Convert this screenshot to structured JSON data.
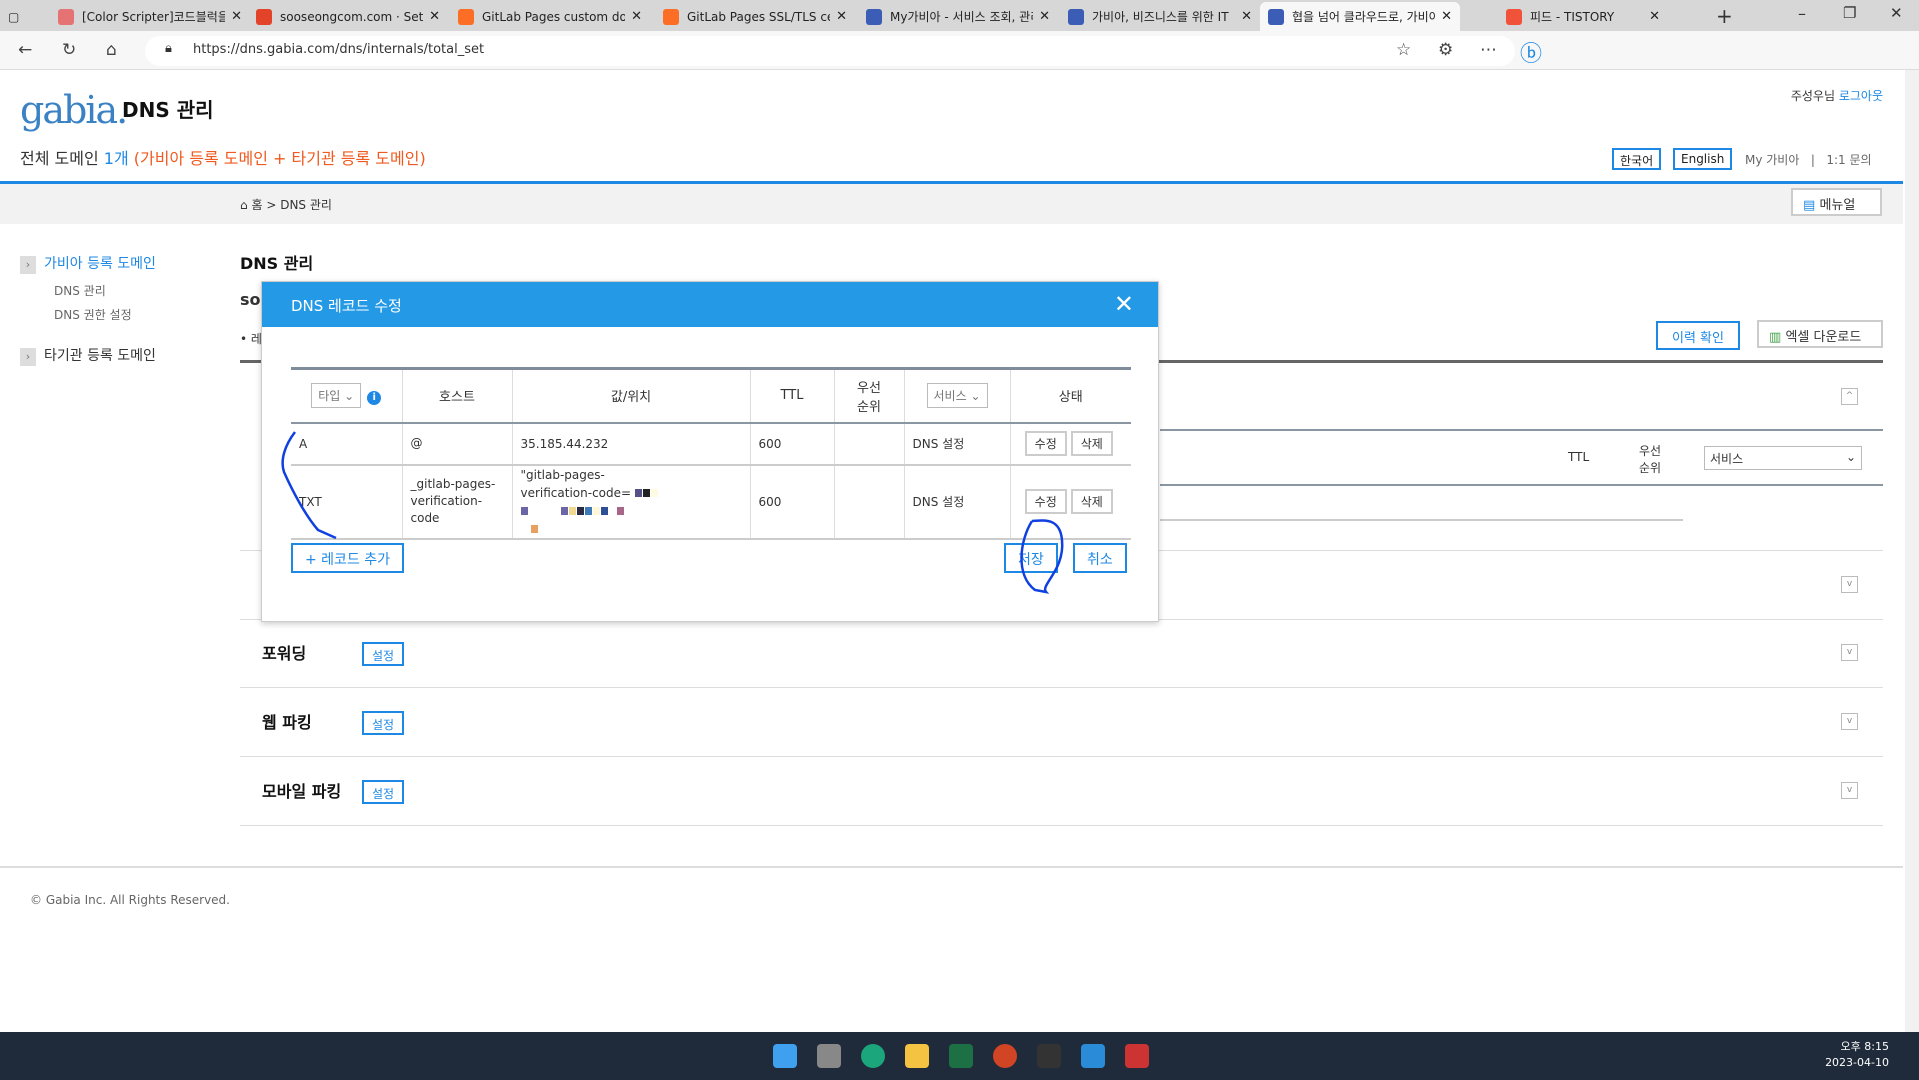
{
  "browser": {
    "tabs": [
      {
        "title": "[Color Scripter]코드블럭을",
        "color": "#e57373"
      },
      {
        "title": "sooseongcom.com · Settings",
        "color": "#e24329"
      },
      {
        "title": "GitLab Pages custom dom",
        "color": "#fc6d26"
      },
      {
        "title": "GitLab Pages SSL/TLS cert",
        "color": "#fc6d26"
      },
      {
        "title": "My가비아 - 서비스 조회, 관리",
        "color": "#3b5db5"
      },
      {
        "title": "가비아, 비즈니스를 위한 IT",
        "color": "#3b5db5"
      },
      {
        "title": "협을 넘어 클라우드로, 가비아",
        "color": "#3b5db5"
      },
      {
        "title": "피드 - TISTORY",
        "color": "#f0533a"
      }
    ],
    "active_tab": 6,
    "url": "https://dns.gabia.com/dns/internals/total_set"
  },
  "header": {
    "logo": "gabia.",
    "title": "DNS 관리",
    "user": "주성우님",
    "logout": "로그아웃",
    "domain_label": "전체 도메인",
    "domain_count": "1개",
    "domain_note": "(가비아 등록 도메인 + 타기관 등록 도메인)",
    "lang_ko": "한국어",
    "lang_en": "English",
    "my_gabia": "My 가비아",
    "separator": "|",
    "inquiry": "1:1 문의"
  },
  "breadcrumb": {
    "home": "홈",
    "sep": ">",
    "current": "DNS 관리",
    "manual": "메뉴얼"
  },
  "sidebar": {
    "group1": "가비아 등록 도메인",
    "items": [
      "DNS 관리",
      "DNS 권한 설정"
    ],
    "group2": "타기관 등록 도메인"
  },
  "main": {
    "heading": "DNS 관리",
    "domain_prefix": "so",
    "bullet": "• 레",
    "history_btn": "이력 확인",
    "excel_btn": "엑셀 다운로드",
    "bg_ttl": "TTL",
    "bg_priority": "우선 순위",
    "bg_service": "서비스",
    "sections": [
      {
        "label": "포워딩",
        "btn": "설정"
      },
      {
        "label": "웹 파킹",
        "btn": "설정"
      },
      {
        "label": "모바일 파킹",
        "btn": "설정"
      }
    ]
  },
  "modal": {
    "title": "DNS 레코드 수정",
    "columns": {
      "type": "타입",
      "host": "호스트",
      "value": "값/위치",
      "ttl": "TTL",
      "priority": "우선 순위",
      "service": "서비스",
      "status": "상태"
    },
    "rows": [
      {
        "type": "A",
        "host": "@",
        "value": "35.185.44.232",
        "ttl": "600",
        "priority": "",
        "service": "DNS 설정",
        "edit": "수정",
        "delete": "삭제"
      },
      {
        "type": "TXT",
        "host": "_gitlab-pages-verification-code",
        "value": "\"gitlab-pages-verification-code=",
        "ttl": "600",
        "priority": "",
        "service": "DNS 설정",
        "edit": "수정",
        "delete": "삭제"
      }
    ],
    "add_btn": "+ 레코드 추가",
    "save_btn": "저장",
    "cancel_btn": "취소"
  },
  "footer": {
    "copyright": "© Gabia Inc. All Rights Reserved."
  },
  "taskbar": {
    "time": "오후 8:15",
    "date": "2023-04-10"
  },
  "colors": {
    "accent": "#1e88e5",
    "modal_header": "#2499e6",
    "orange": "#f05a1e",
    "annotation": "#1040e0"
  }
}
